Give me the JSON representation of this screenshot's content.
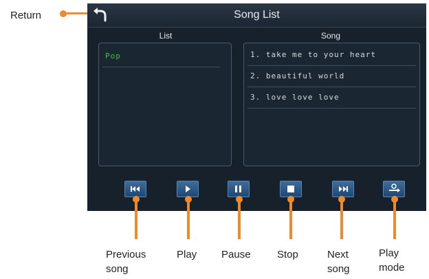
{
  "annotations": {
    "return": "Return",
    "previous_song": [
      "Previous",
      "song"
    ],
    "play": "Play",
    "pause": "Pause",
    "stop": "Stop",
    "next_song": [
      "Next",
      "song"
    ],
    "play_mode": [
      "Play",
      "mode"
    ]
  },
  "header": {
    "title": "Song List"
  },
  "list_panel": {
    "heading": "List",
    "items": [
      {
        "label": "Pop",
        "selected": true
      }
    ]
  },
  "song_panel": {
    "heading": "Song",
    "items": [
      {
        "label": "1. take me to your heart"
      },
      {
        "label": "2. beautiful world"
      },
      {
        "label": "3. love love love"
      }
    ]
  },
  "controls": [
    {
      "name": "previous-song",
      "icon": "skip-back-icon"
    },
    {
      "name": "play",
      "icon": "play-icon"
    },
    {
      "name": "pause",
      "icon": "pause-icon"
    },
    {
      "name": "stop",
      "icon": "stop-icon"
    },
    {
      "name": "next-song",
      "icon": "skip-forward-icon"
    },
    {
      "name": "play-mode",
      "icon": "play-mode-icon"
    }
  ],
  "colors": {
    "callout": "#ef8a2a",
    "screen": "#16212c",
    "selected_text": "#41c23d",
    "button": "#2c5a88"
  }
}
